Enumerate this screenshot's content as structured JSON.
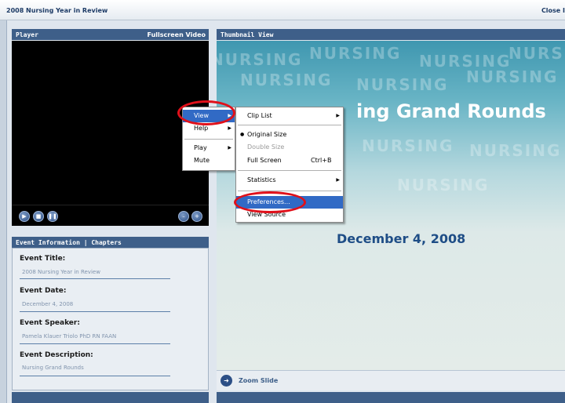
{
  "window": {
    "title": "2008 Nursing Year in Review",
    "close_label": "Close I"
  },
  "player": {
    "header_label": "Player",
    "fullscreen_label": "Fullscreen Video",
    "controls": [
      "play-icon",
      "stop-icon",
      "pause-icon",
      "volume-down-icon",
      "volume-up-icon"
    ]
  },
  "thumbnail": {
    "header_label": "Thumbnail View"
  },
  "slide": {
    "title": "ing Grand Rounds",
    "date": "December 4, 2008",
    "watermark": "NURSING"
  },
  "event_info": {
    "header_label": "Event Information | Chapters",
    "fields": [
      {
        "label": "Event Title:",
        "value": "2008 Nursing Year in Review"
      },
      {
        "label": "Event Date:",
        "value": "December 4, 2008"
      },
      {
        "label": "Event Speaker:",
        "value": "Pamela Klauer Triolo PhD RN FAAN"
      },
      {
        "label": "Event Description:",
        "value": "Nursing Grand Rounds"
      }
    ]
  },
  "zoom": {
    "label": "Zoom Slide"
  },
  "context_menu": {
    "items": [
      "View",
      "Help",
      "Play",
      "Mute"
    ]
  },
  "view_submenu": {
    "items": [
      "Clip List",
      "Original Size",
      "Double Size",
      "Full Screen",
      "Statistics",
      "Preferences...",
      "View Source"
    ],
    "full_screen_shortcut": "Ctrl+B"
  },
  "colors": {
    "accent_header": "#3e5f89",
    "highlight": "#316ac5",
    "annotation_ring": "#e0101a"
  }
}
